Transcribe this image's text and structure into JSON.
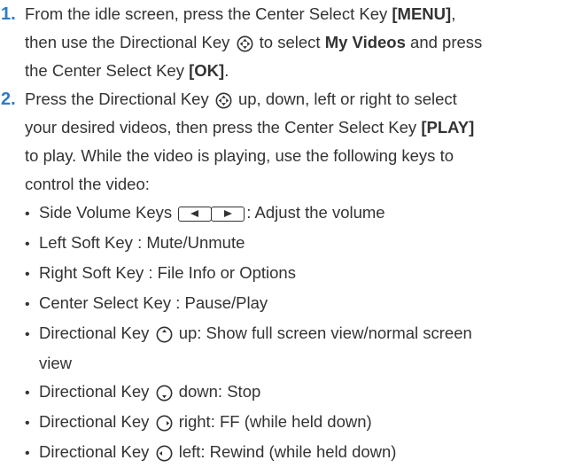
{
  "steps": [
    {
      "number": "1.",
      "line1": {
        "a": "From the idle screen, press the Center Select Key ",
        "b": "[MENU]",
        "c": ","
      },
      "line2": {
        "a": "then use the Directional Key ",
        "b": " to select ",
        "c": "My Videos",
        "d": " and press"
      },
      "line3": {
        "a": "the Center Select Key ",
        "b": "[OK]",
        "c": "."
      }
    },
    {
      "number": "2.",
      "line1": {
        "a": "Press the Directional Key ",
        "b": " up, down, left or right to select"
      },
      "line2": {
        "a": "your desired videos, then press the Center Select Key ",
        "b": "[PLAY]"
      },
      "line3": "to play. While the video is playing, use the following keys to",
      "line4": "control the video:",
      "bullets": {
        "volume": {
          "a": "Side Volume Keys ",
          "b": ": Adjust the volume"
        },
        "left_soft": "Left Soft Key : Mute/Unmute",
        "right_soft": "Right Soft Key : File Info or Options",
        "center": "Center Select Key : Pause/Play",
        "dir_up": {
          "a": "Directional Key ",
          "b": " up: Show full screen view/normal screen",
          "c": "view"
        },
        "dir_down": {
          "a": "Directional Key ",
          "b": " down: Stop"
        },
        "dir_right": {
          "a": "Directional Key ",
          "b": " right: FF (while held down)"
        },
        "dir_left": {
          "a": "Directional Key ",
          "b": " left: Rewind (while held down)"
        }
      }
    }
  ],
  "bullet_glyph": "•",
  "icons": {
    "directional": "directional-key-icon",
    "volume_down": "volume-down-key-icon",
    "volume_up": "volume-up-key-icon",
    "dir_up": "directional-up-icon",
    "dir_down": "directional-down-icon",
    "dir_right": "directional-right-icon",
    "dir_left": "directional-left-icon"
  },
  "colors": {
    "step_number": "#2e7cc6",
    "text": "#333333"
  }
}
